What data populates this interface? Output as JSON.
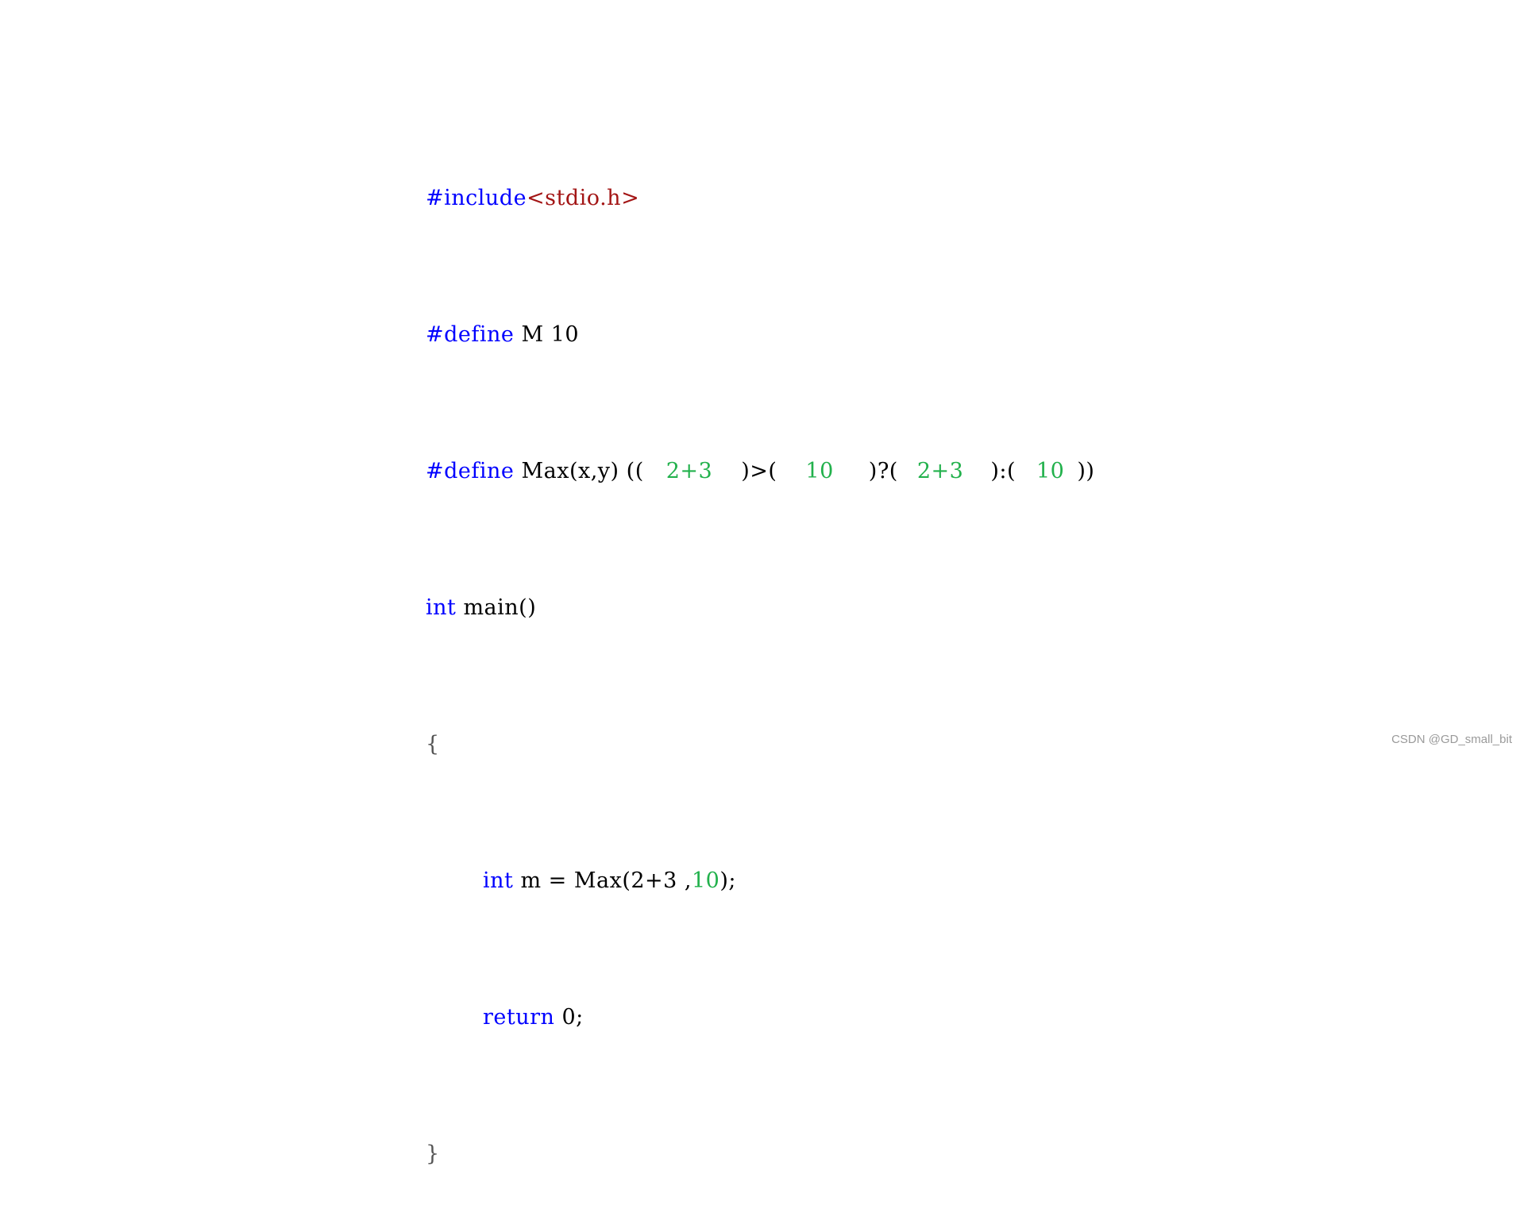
{
  "colors": {
    "keyword": "#0000ff",
    "string": "#a31515",
    "number": "#22b14c",
    "plain": "#000000",
    "watermark": "#9a9a9a"
  },
  "code": {
    "line1": {
      "directive": "#include",
      "header": "<stdio.h>"
    },
    "line2": {
      "directive": "#define",
      "rest": " M 10"
    },
    "line3": {
      "directive": "#define",
      "macro": " Max(x,y) ((",
      "arg1": "2+3",
      "op1": ")>(",
      "arg2": "10",
      "op2": ")?(",
      "arg3": "2+3",
      "op3": "):(",
      "arg4": "10",
      "close": "))"
    },
    "line4": {
      "type": "int",
      "rest": " main()"
    },
    "line5": {
      "brace": "{"
    },
    "line6": {
      "type": "int",
      "rest": " m = Max(2+3 ,",
      "num": "10",
      "end": ");"
    },
    "line7": {
      "keyword": "return",
      "rest": " 0;"
    },
    "line8": {
      "brace": "}"
    }
  },
  "watermark": "CSDN @GD_small_bit"
}
